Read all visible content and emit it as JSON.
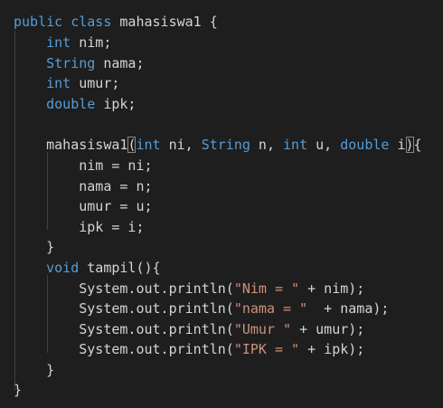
{
  "code": {
    "lines": [
      "public class mahasiswa1 {",
      "    int nim;",
      "    String nama;",
      "    int umur;",
      "    double ipk;",
      "",
      "    mahasiswa1(int ni, String n, int u, double i){",
      "        nim = ni;",
      "        nama = n;",
      "        umur = u;",
      "        ipk = i;",
      "    }",
      "    void tampil(){",
      "        System.out.println(\"Nim = \" + nim);",
      "        System.out.println(\"nama = \"  + nama);",
      "        System.out.println(\"Umur \" + umur);",
      "        System.out.println(\"IPK = \" + ipk);",
      "    }",
      "}"
    ]
  },
  "theme": {
    "background": "#1e1e1e",
    "keyword": "#569cd6",
    "string": "#ce9178",
    "text": "#d4d4d4"
  }
}
